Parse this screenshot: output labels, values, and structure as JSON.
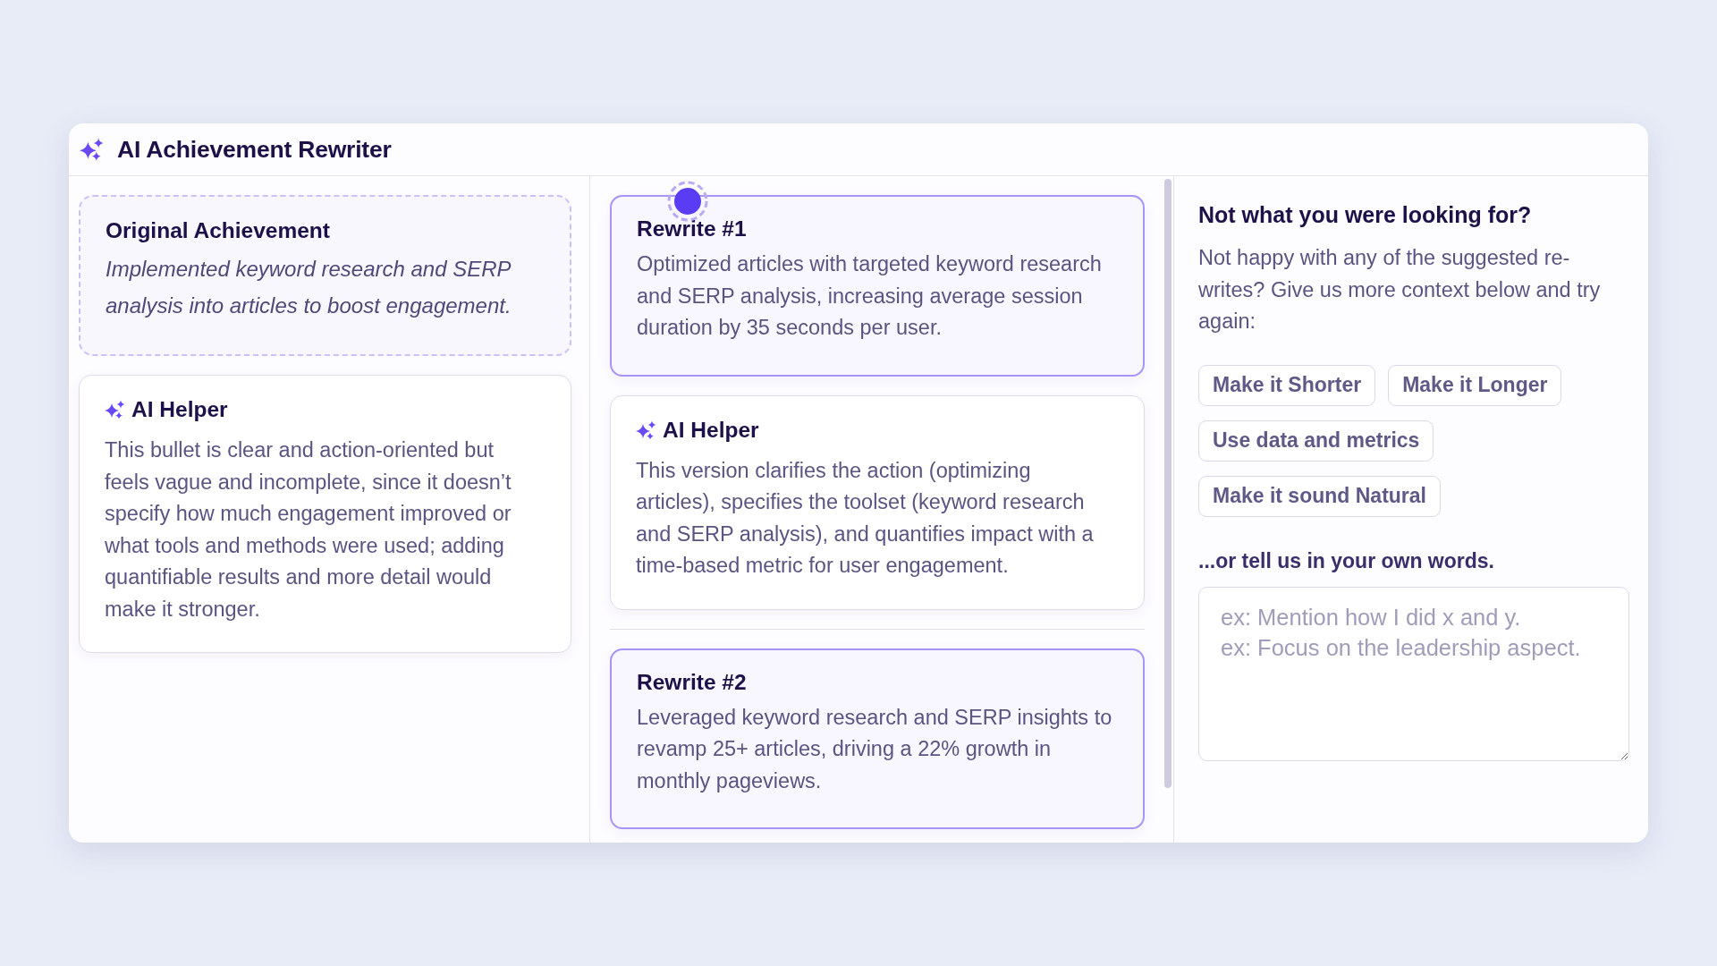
{
  "window": {
    "title": "AI Achievement Rewriter"
  },
  "original": {
    "heading": "Original Achievement",
    "text": "Implemented keyword research and SERP analysis into articles to boost engagement.",
    "helper": {
      "title": "AI Helper",
      "text": "This bullet is clear and action-oriented but feels vague and incomplete, since it doesn’t specify how much engagement improved or what tools and methods were used; adding quantifiable results and more detail would make it stronger."
    }
  },
  "rewrites": [
    {
      "title": "Rewrite #1",
      "text": "Optimized articles with targeted keyword research and SERP analysis, increasing average session duration by 35 seconds per user.",
      "hotspot": true,
      "helper": {
        "title": "AI Helper",
        "text": "This version clarifies the action (optimizing articles), specifies the toolset (keyword research and SERP analysis), and quantifies impact with a time-based metric for user engagement."
      }
    },
    {
      "title": "Rewrite #2",
      "text": "Leveraged keyword research and SERP insights to revamp 25+ articles, driving a 22% growth in monthly pageviews.",
      "hotspot": false
    }
  ],
  "feedback": {
    "heading": "Not what you were looking for?",
    "text": "Not happy with any of the suggested re-writes? Give us more context below and try again:",
    "options": [
      "Make it Shorter",
      "Make it Longer",
      "Use data and metrics",
      "Make it sound Natural"
    ],
    "custom_label": "...or tell us in your own words.",
    "custom_input": {
      "placeholder": "ex: Mention how I did x and y.\nex: Focus on the leadership aspect."
    }
  }
}
